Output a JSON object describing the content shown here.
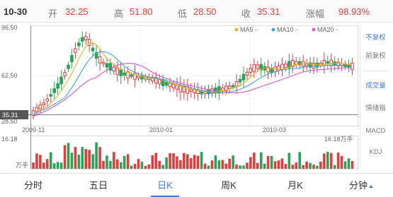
{
  "header": {
    "date": "10-30",
    "open_label": "开",
    "open_value": "32.25",
    "high_label": "高",
    "high_value": "51.80",
    "low_label": "低",
    "low_value": "28.50",
    "close_label": "收",
    "close_value": "35.31",
    "change_label": "涨幅",
    "change_value": "98.93%"
  },
  "chart": {
    "y_max_label": "96.50",
    "y_mid_label": "62.50",
    "y_min_label": "28.50",
    "current_price_label": "35.31",
    "date_labels": [
      "2009-11",
      "2010-01",
      "2010-03"
    ],
    "volume_max_label": "16.18",
    "volume_right_label": "16.18万手",
    "volume_unit_label": "万手"
  },
  "legend": {
    "ma5": "MA5 -",
    "ma10": "MA10 -",
    "ma20": "MA20 -"
  },
  "colors": {
    "up": "#e63b3b",
    "down": "#27a35a",
    "ma5": "#f2b01e",
    "ma10": "#3aa7d9",
    "ma20": "#d25ad2",
    "accent": "#3b78e7"
  },
  "side_menu": {
    "no_adjust": "不复权",
    "pre_adjust": "前复权",
    "volume": "成交量",
    "sentiment": "情绪指",
    "macd": "MACD",
    "kdj": "KDJ"
  },
  "tabs": {
    "minute": "分时",
    "five_day": "五日",
    "day_k": "日K",
    "week_k": "周K",
    "month_k": "月K",
    "minutes": "分钟"
  }
}
